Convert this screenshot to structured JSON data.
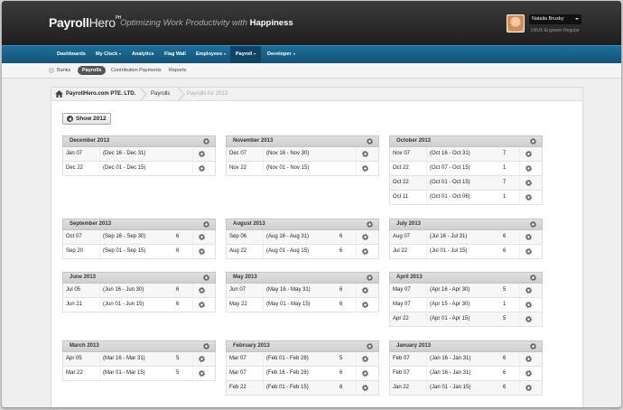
{
  "app": {
    "logo_bold": "Payroll",
    "logo_lite": "Hero",
    "logo_sup": "PH",
    "tagline": "Optimizing Work Productivity with",
    "tagline_bold": "Happiness",
    "user_name": "Natalia Brusky",
    "user_role": "UI/UX Engineer Regular"
  },
  "nav": {
    "items": [
      {
        "label": "Dashboards"
      },
      {
        "label": "My Clock"
      },
      {
        "label": "Analytics"
      },
      {
        "label": "Flag Wall"
      },
      {
        "label": "Employees"
      },
      {
        "label": "Payroll"
      },
      {
        "label": "Developer"
      }
    ]
  },
  "subnav": {
    "items": [
      {
        "label": "Banks"
      },
      {
        "label": "Payrolls"
      },
      {
        "label": "Contribution Payments"
      },
      {
        "label": "Reports"
      }
    ]
  },
  "breadcrumb": {
    "company": "PayrollHero.com PTE. LTD.",
    "section": "Payrolls",
    "current": "Payrolls for 2013"
  },
  "show_button": "Show 2012",
  "months": [
    {
      "name": "December 2013",
      "rows": [
        {
          "date": "Jan 07",
          "range": "(Dec 16 - Dec 31)",
          "count": ""
        },
        {
          "date": "Dec 22",
          "range": "(Dec 01 - Dec 15)",
          "count": ""
        }
      ]
    },
    {
      "name": "November 2013",
      "rows": [
        {
          "date": "Dec 07",
          "range": "(Nov 16 - Nov 30)",
          "count": ""
        },
        {
          "date": "Nov 22",
          "range": "(Nov 01 - Nov 15)",
          "count": ""
        }
      ]
    },
    {
      "name": "October 2013",
      "rows": [
        {
          "date": "Nov 07",
          "range": "(Oct 16 - Oct 31)",
          "count": "7"
        },
        {
          "date": "Oct 22",
          "range": "(Oct 07 - Oct 15)",
          "count": "1"
        },
        {
          "date": "Oct 22",
          "range": "(Oct 01 - Oct 15)",
          "count": "7"
        },
        {
          "date": "Oct 11",
          "range": "(Oct 01 - Oct 06)",
          "count": "1"
        }
      ]
    },
    {
      "name": "September 2013",
      "rows": [
        {
          "date": "Oct 07",
          "range": "(Sep 16 - Sep 30)",
          "count": "6"
        },
        {
          "date": "Sep 20",
          "range": "(Sep 01 - Sep 15)",
          "count": "6"
        }
      ]
    },
    {
      "name": "August 2013",
      "rows": [
        {
          "date": "Sep 06",
          "range": "(Aug 16 - Aug 31)",
          "count": "6"
        },
        {
          "date": "Aug 22",
          "range": "(Aug 01 - Aug 15)",
          "count": "6"
        }
      ]
    },
    {
      "name": "July 2013",
      "rows": [
        {
          "date": "Aug 07",
          "range": "(Jul 16 - Jul 31)",
          "count": "6"
        },
        {
          "date": "Jul 22",
          "range": "(Jul 01 - Jul 15)",
          "count": "6"
        }
      ]
    },
    {
      "name": "June 2013",
      "rows": [
        {
          "date": "Jul 05",
          "range": "(Jun 16 - Jun 30)",
          "count": "6"
        },
        {
          "date": "Jun 21",
          "range": "(Jun 01 - Jun 15)",
          "count": "6"
        }
      ]
    },
    {
      "name": "May 2013",
      "rows": [
        {
          "date": "Jun 07",
          "range": "(May 16 - May 31)",
          "count": "6"
        },
        {
          "date": "May 22",
          "range": "(May 01 - May 15)",
          "count": "6"
        }
      ]
    },
    {
      "name": "April 2013",
      "rows": [
        {
          "date": "May 07",
          "range": "(Apr 16 - Apr 30)",
          "count": "5"
        },
        {
          "date": "May 07",
          "range": "(Apr 15 - Apr 30)",
          "count": "1"
        },
        {
          "date": "Apr 22",
          "range": "(Apr 01 - Apr 15)",
          "count": "5"
        }
      ]
    },
    {
      "name": "March 2013",
      "rows": [
        {
          "date": "Apr 05",
          "range": "(Mar 16 - Mar 31)",
          "count": "5"
        },
        {
          "date": "Mar 22",
          "range": "(Mar 01 - Mar 15)",
          "count": "5"
        }
      ]
    },
    {
      "name": "February 2013",
      "rows": [
        {
          "date": "Mar 07",
          "range": "(Feb 01 - Feb 28)",
          "count": "5"
        },
        {
          "date": "Mar 07",
          "range": "(Feb 16 - Feb 28)",
          "count": "6"
        },
        {
          "date": "Feb 22",
          "range": "(Feb 01 - Feb 15)",
          "count": "6"
        }
      ]
    },
    {
      "name": "January 2013",
      "rows": [
        {
          "date": "Feb 07",
          "range": "(Jan 16 - Jan 31)",
          "count": "6"
        },
        {
          "date": "Feb 07",
          "range": "(Jan 16 - Jan 31)",
          "count": "6"
        },
        {
          "date": "Jan 22",
          "range": "(Jan 01 - Jan 15)",
          "count": "6"
        }
      ]
    }
  ]
}
